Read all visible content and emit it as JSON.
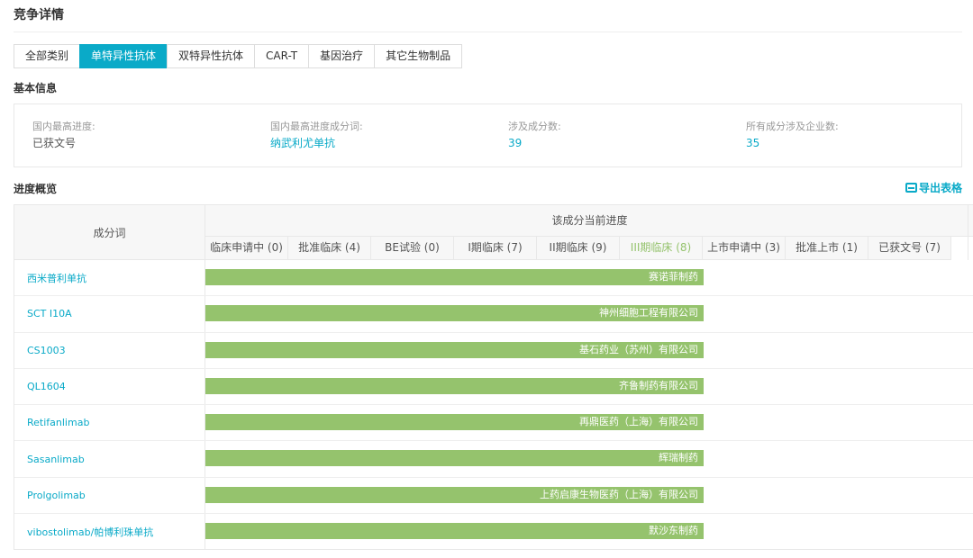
{
  "page": {
    "title": "竞争详情"
  },
  "tabs": [
    {
      "label": "全部类别",
      "active": false
    },
    {
      "label": "单特异性抗体",
      "active": true
    },
    {
      "label": "双特异性抗体",
      "active": false
    },
    {
      "label": "CAR-T",
      "active": false
    },
    {
      "label": "基因治疗",
      "active": false
    },
    {
      "label": "其它生物制品",
      "active": false
    }
  ],
  "basic_info": {
    "section_title": "基本信息",
    "items": [
      {
        "label": "国内最高进度:",
        "value": "已获文号"
      },
      {
        "label": "国内最高进度成分词:",
        "value": "纳武利尤单抗"
      },
      {
        "label": "涉及成分数:",
        "value": "39"
      },
      {
        "label": "所有成分涉及企业数:",
        "value": "35"
      }
    ]
  },
  "progress": {
    "section_title": "进度概览",
    "export_label": "导出表格",
    "col_component": "成分词",
    "col_progress": "该成分当前进度",
    "stages": [
      {
        "label": "临床申请中 (0)"
      },
      {
        "label": "批准临床 (4)"
      },
      {
        "label": "BE试验 (0)"
      },
      {
        "label": "I期临床 (7)"
      },
      {
        "label": "II期临床 (9)"
      },
      {
        "label": "III期临床 (8)"
      },
      {
        "label": "上市申请中 (3)"
      },
      {
        "label": "批准上市 (1)"
      },
      {
        "label": "已获文号 (7)"
      }
    ],
    "current_stage_index": 5,
    "rows": [
      {
        "name": "西米普利单抗",
        "company": "赛诺菲制药",
        "stage_index": 5
      },
      {
        "name": "SCT I10A",
        "company": "神州细胞工程有限公司",
        "stage_index": 5
      },
      {
        "name": "CS1003",
        "company": "基石药业（苏州）有限公司",
        "stage_index": 5
      },
      {
        "name": "QL1604",
        "company": "齐鲁制药有限公司",
        "stage_index": 5
      },
      {
        "name": "Retifanlimab",
        "company": "再鼎医药（上海）有限公司",
        "stage_index": 5
      },
      {
        "name": "Sasanlimab",
        "company": "辉瑞制药",
        "stage_index": 5
      },
      {
        "name": "Prolgolimab",
        "company": "上药启康生物医药（上海）有限公司",
        "stage_index": 5
      },
      {
        "name": "vibostolimab/帕博利珠单抗",
        "company": "默沙东制药",
        "stage_index": 5
      }
    ],
    "colors": {
      "bar": "#95c36d",
      "accent": "#0aaac8"
    }
  }
}
